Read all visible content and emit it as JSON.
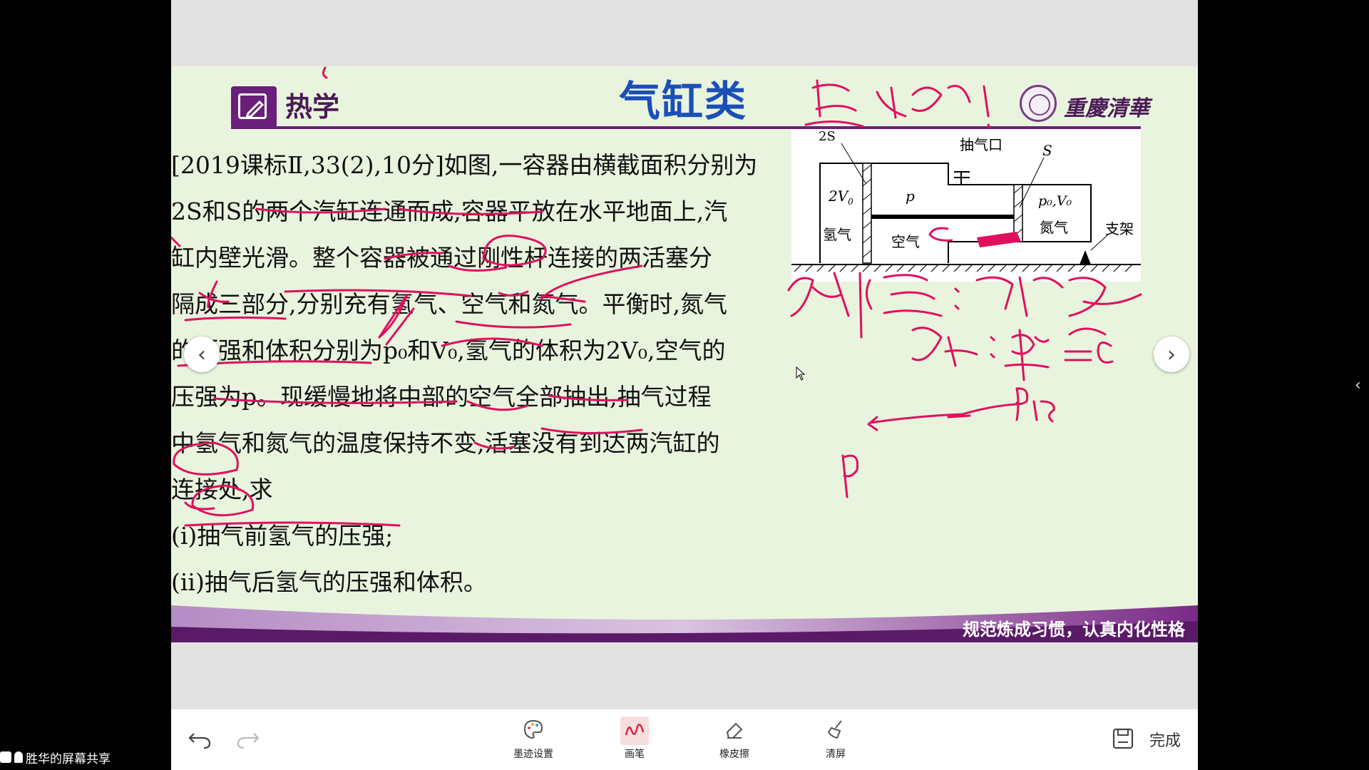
{
  "slide": {
    "subject": "热学",
    "title": "气缸类",
    "school": "重慶清華",
    "footer": "规范炼成习惯，认真内化性格",
    "problem_lines": [
      "[2019课标Ⅱ,33(2),10分]如图,一容器由横截面积分别为",
      "2S和S的两个汽缸连通而成,容器平放在水平地面上,汽",
      "缸内壁光滑。整个容器被通过刚性杆连接的两活塞分",
      "隔成三部分,分别充有氢气、空气和氮气。平衡时,氮气",
      "的压强和体积分别为p₀和V₀,氢气的体积为2V₀,空气的",
      "压强为p。现缓慢地将中部的空气全部抽出,抽气过程",
      "中氢气和氮气的温度保持不变,活塞没有到达两汽缸的",
      "连接处,求",
      "(i)抽气前氢气的压强;",
      "(ii)抽气后氢气的压强和体积。"
    ],
    "diagram": {
      "label_2s": "2S",
      "label_vent": "抽气口",
      "label_s": "S",
      "label_2v0": "2V",
      "label_2v0_sub": "0",
      "label_h2": "氢气",
      "label_p": "p",
      "label_air": "空气",
      "label_p0v0": "p₀,V₀",
      "label_n2": "氮气",
      "label_stand": "支架"
    }
  },
  "toolbar": {
    "ink_settings": "墨迹设置",
    "pen": "画笔",
    "eraser": "橡皮擦",
    "clear": "清屏",
    "done": "完成"
  },
  "share_label": "胜华的屏幕共享",
  "colors": {
    "slide_bg": "#e9f4de",
    "brand_purple": "#6a1f7a",
    "title_blue": "#1b4fb8",
    "ink_magenta": "#e0105e"
  }
}
